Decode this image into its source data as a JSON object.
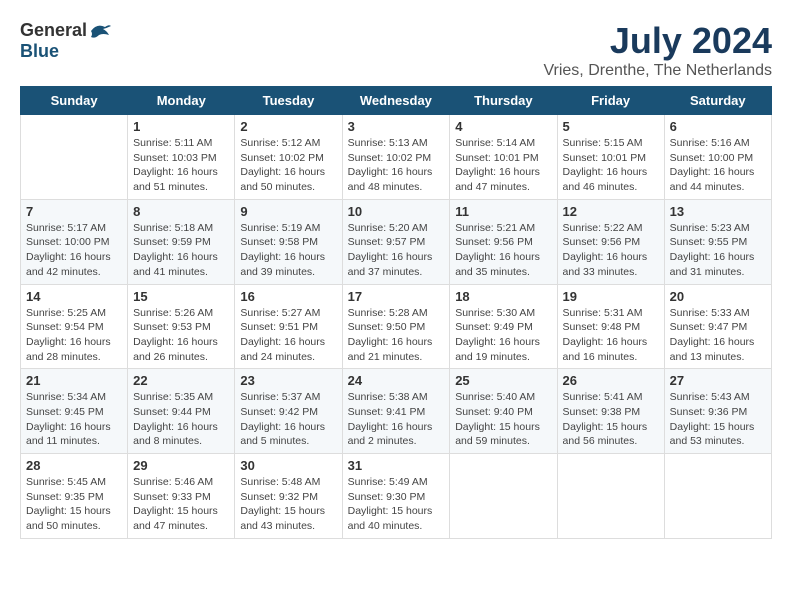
{
  "header": {
    "logo_general": "General",
    "logo_blue": "Blue",
    "month_year": "July 2024",
    "location": "Vries, Drenthe, The Netherlands"
  },
  "days_of_week": [
    "Sunday",
    "Monday",
    "Tuesday",
    "Wednesday",
    "Thursday",
    "Friday",
    "Saturday"
  ],
  "weeks": [
    [
      {
        "day": "",
        "sunrise": "",
        "sunset": "",
        "daylight": ""
      },
      {
        "day": "1",
        "sunrise": "Sunrise: 5:11 AM",
        "sunset": "Sunset: 10:03 PM",
        "daylight": "Daylight: 16 hours and 51 minutes."
      },
      {
        "day": "2",
        "sunrise": "Sunrise: 5:12 AM",
        "sunset": "Sunset: 10:02 PM",
        "daylight": "Daylight: 16 hours and 50 minutes."
      },
      {
        "day": "3",
        "sunrise": "Sunrise: 5:13 AM",
        "sunset": "Sunset: 10:02 PM",
        "daylight": "Daylight: 16 hours and 48 minutes."
      },
      {
        "day": "4",
        "sunrise": "Sunrise: 5:14 AM",
        "sunset": "Sunset: 10:01 PM",
        "daylight": "Daylight: 16 hours and 47 minutes."
      },
      {
        "day": "5",
        "sunrise": "Sunrise: 5:15 AM",
        "sunset": "Sunset: 10:01 PM",
        "daylight": "Daylight: 16 hours and 46 minutes."
      },
      {
        "day": "6",
        "sunrise": "Sunrise: 5:16 AM",
        "sunset": "Sunset: 10:00 PM",
        "daylight": "Daylight: 16 hours and 44 minutes."
      }
    ],
    [
      {
        "day": "7",
        "sunrise": "Sunrise: 5:17 AM",
        "sunset": "Sunset: 10:00 PM",
        "daylight": "Daylight: 16 hours and 42 minutes."
      },
      {
        "day": "8",
        "sunrise": "Sunrise: 5:18 AM",
        "sunset": "Sunset: 9:59 PM",
        "daylight": "Daylight: 16 hours and 41 minutes."
      },
      {
        "day": "9",
        "sunrise": "Sunrise: 5:19 AM",
        "sunset": "Sunset: 9:58 PM",
        "daylight": "Daylight: 16 hours and 39 minutes."
      },
      {
        "day": "10",
        "sunrise": "Sunrise: 5:20 AM",
        "sunset": "Sunset: 9:57 PM",
        "daylight": "Daylight: 16 hours and 37 minutes."
      },
      {
        "day": "11",
        "sunrise": "Sunrise: 5:21 AM",
        "sunset": "Sunset: 9:56 PM",
        "daylight": "Daylight: 16 hours and 35 minutes."
      },
      {
        "day": "12",
        "sunrise": "Sunrise: 5:22 AM",
        "sunset": "Sunset: 9:56 PM",
        "daylight": "Daylight: 16 hours and 33 minutes."
      },
      {
        "day": "13",
        "sunrise": "Sunrise: 5:23 AM",
        "sunset": "Sunset: 9:55 PM",
        "daylight": "Daylight: 16 hours and 31 minutes."
      }
    ],
    [
      {
        "day": "14",
        "sunrise": "Sunrise: 5:25 AM",
        "sunset": "Sunset: 9:54 PM",
        "daylight": "Daylight: 16 hours and 28 minutes."
      },
      {
        "day": "15",
        "sunrise": "Sunrise: 5:26 AM",
        "sunset": "Sunset: 9:53 PM",
        "daylight": "Daylight: 16 hours and 26 minutes."
      },
      {
        "day": "16",
        "sunrise": "Sunrise: 5:27 AM",
        "sunset": "Sunset: 9:51 PM",
        "daylight": "Daylight: 16 hours and 24 minutes."
      },
      {
        "day": "17",
        "sunrise": "Sunrise: 5:28 AM",
        "sunset": "Sunset: 9:50 PM",
        "daylight": "Daylight: 16 hours and 21 minutes."
      },
      {
        "day": "18",
        "sunrise": "Sunrise: 5:30 AM",
        "sunset": "Sunset: 9:49 PM",
        "daylight": "Daylight: 16 hours and 19 minutes."
      },
      {
        "day": "19",
        "sunrise": "Sunrise: 5:31 AM",
        "sunset": "Sunset: 9:48 PM",
        "daylight": "Daylight: 16 hours and 16 minutes."
      },
      {
        "day": "20",
        "sunrise": "Sunrise: 5:33 AM",
        "sunset": "Sunset: 9:47 PM",
        "daylight": "Daylight: 16 hours and 13 minutes."
      }
    ],
    [
      {
        "day": "21",
        "sunrise": "Sunrise: 5:34 AM",
        "sunset": "Sunset: 9:45 PM",
        "daylight": "Daylight: 16 hours and 11 minutes."
      },
      {
        "day": "22",
        "sunrise": "Sunrise: 5:35 AM",
        "sunset": "Sunset: 9:44 PM",
        "daylight": "Daylight: 16 hours and 8 minutes."
      },
      {
        "day": "23",
        "sunrise": "Sunrise: 5:37 AM",
        "sunset": "Sunset: 9:42 PM",
        "daylight": "Daylight: 16 hours and 5 minutes."
      },
      {
        "day": "24",
        "sunrise": "Sunrise: 5:38 AM",
        "sunset": "Sunset: 9:41 PM",
        "daylight": "Daylight: 16 hours and 2 minutes."
      },
      {
        "day": "25",
        "sunrise": "Sunrise: 5:40 AM",
        "sunset": "Sunset: 9:40 PM",
        "daylight": "Daylight: 15 hours and 59 minutes."
      },
      {
        "day": "26",
        "sunrise": "Sunrise: 5:41 AM",
        "sunset": "Sunset: 9:38 PM",
        "daylight": "Daylight: 15 hours and 56 minutes."
      },
      {
        "day": "27",
        "sunrise": "Sunrise: 5:43 AM",
        "sunset": "Sunset: 9:36 PM",
        "daylight": "Daylight: 15 hours and 53 minutes."
      }
    ],
    [
      {
        "day": "28",
        "sunrise": "Sunrise: 5:45 AM",
        "sunset": "Sunset: 9:35 PM",
        "daylight": "Daylight: 15 hours and 50 minutes."
      },
      {
        "day": "29",
        "sunrise": "Sunrise: 5:46 AM",
        "sunset": "Sunset: 9:33 PM",
        "daylight": "Daylight: 15 hours and 47 minutes."
      },
      {
        "day": "30",
        "sunrise": "Sunrise: 5:48 AM",
        "sunset": "Sunset: 9:32 PM",
        "daylight": "Daylight: 15 hours and 43 minutes."
      },
      {
        "day": "31",
        "sunrise": "Sunrise: 5:49 AM",
        "sunset": "Sunset: 9:30 PM",
        "daylight": "Daylight: 15 hours and 40 minutes."
      },
      {
        "day": "",
        "sunrise": "",
        "sunset": "",
        "daylight": ""
      },
      {
        "day": "",
        "sunrise": "",
        "sunset": "",
        "daylight": ""
      },
      {
        "day": "",
        "sunrise": "",
        "sunset": "",
        "daylight": ""
      }
    ]
  ]
}
